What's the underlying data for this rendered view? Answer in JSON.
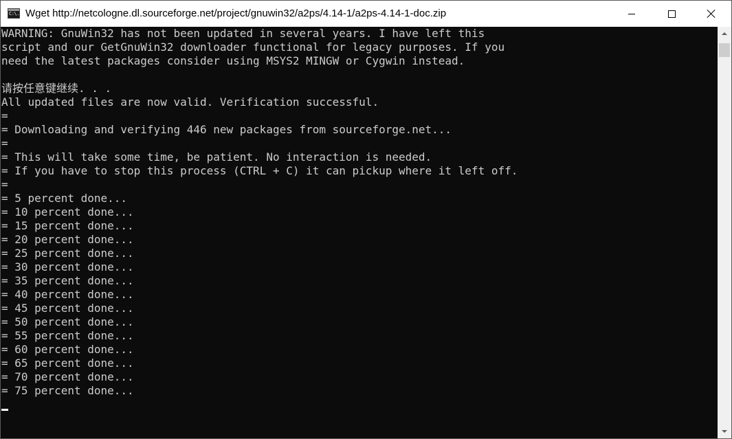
{
  "window": {
    "title": "Wget http://netcologne.dl.sourceforge.net/project/gnuwin32/a2ps/4.14-1/a2ps-4.14-1-doc.zip",
    "icon_name": "console-icon",
    "icon_text": "C:\\."
  },
  "console": {
    "lines": [
      "WARNING: GnuWin32 has not been updated in several years. I have left this",
      "script and our GetGnuWin32 downloader functional for legacy purposes. If you",
      "need the latest packages consider using MSYS2 MINGW or Cygwin instead.",
      "",
      "请按任意键继续. . .",
      "All updated files are now valid. Verification successful.",
      "=",
      "= Downloading and verifying 446 new packages from sourceforge.net...",
      "=",
      "= This will take some time, be patient. No interaction is needed.",
      "= If you have to stop this process (CTRL + C) it can pickup where it left off.",
      "=",
      "= 5 percent done...",
      "= 10 percent done...",
      "= 15 percent done...",
      "= 20 percent done...",
      "= 25 percent done...",
      "= 30 percent done...",
      "= 35 percent done...",
      "= 40 percent done...",
      "= 45 percent done...",
      "= 50 percent done...",
      "= 55 percent done...",
      "= 60 percent done...",
      "= 65 percent done...",
      "= 70 percent done...",
      "= 75 percent done..."
    ],
    "text_color": "#cccccc",
    "background_color": "#0c0c0c"
  }
}
